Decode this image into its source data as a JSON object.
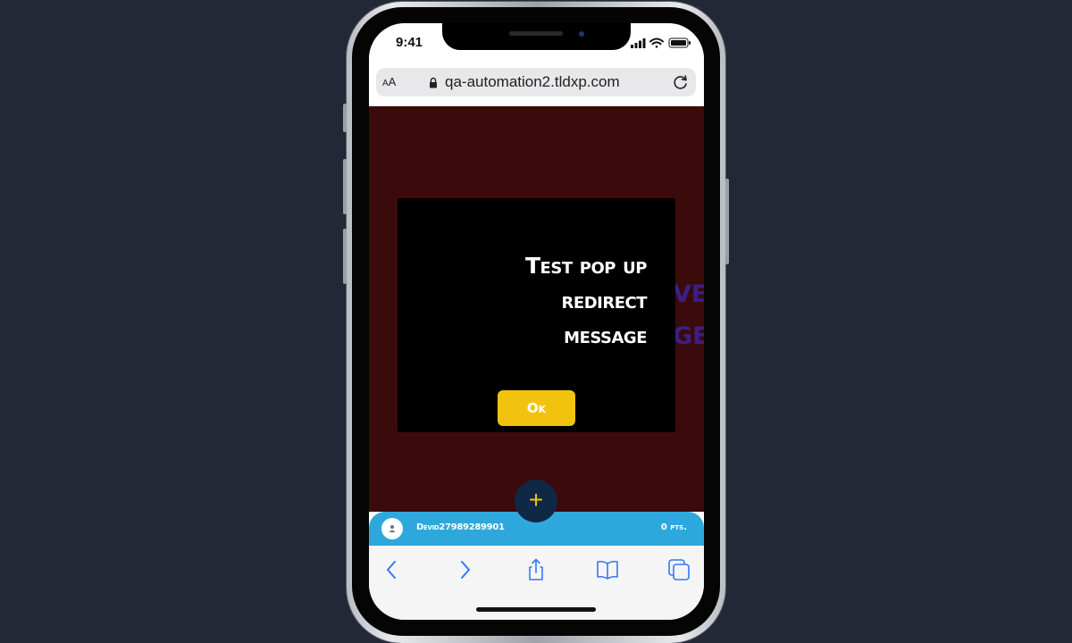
{
  "status_bar": {
    "time": "9:41",
    "icons": [
      "signal-icon",
      "wifi-icon",
      "battery-icon"
    ]
  },
  "browser": {
    "text_size_button": {
      "small": "A",
      "large": "A"
    },
    "url": "qa-automation2.tldxp.com",
    "icons": [
      "lock-icon",
      "reload-icon"
    ]
  },
  "page": {
    "background_color": "#3b0a0a",
    "background_text": [
      "VE",
      "GE"
    ],
    "modal": {
      "title_lines": [
        "Test pop up",
        "redirect",
        "message"
      ],
      "ok_label": "Ok",
      "ok_color": "#f1c30f"
    },
    "fab_label": "+",
    "user_bar": {
      "username": "Devid27989289901",
      "points": "0 pts.",
      "color": "#2ea8dc"
    }
  },
  "safari_toolbar": {
    "icons": [
      "back-icon",
      "forward-icon",
      "share-icon",
      "bookmarks-icon",
      "tabs-icon"
    ],
    "accent": "#3478f6"
  }
}
